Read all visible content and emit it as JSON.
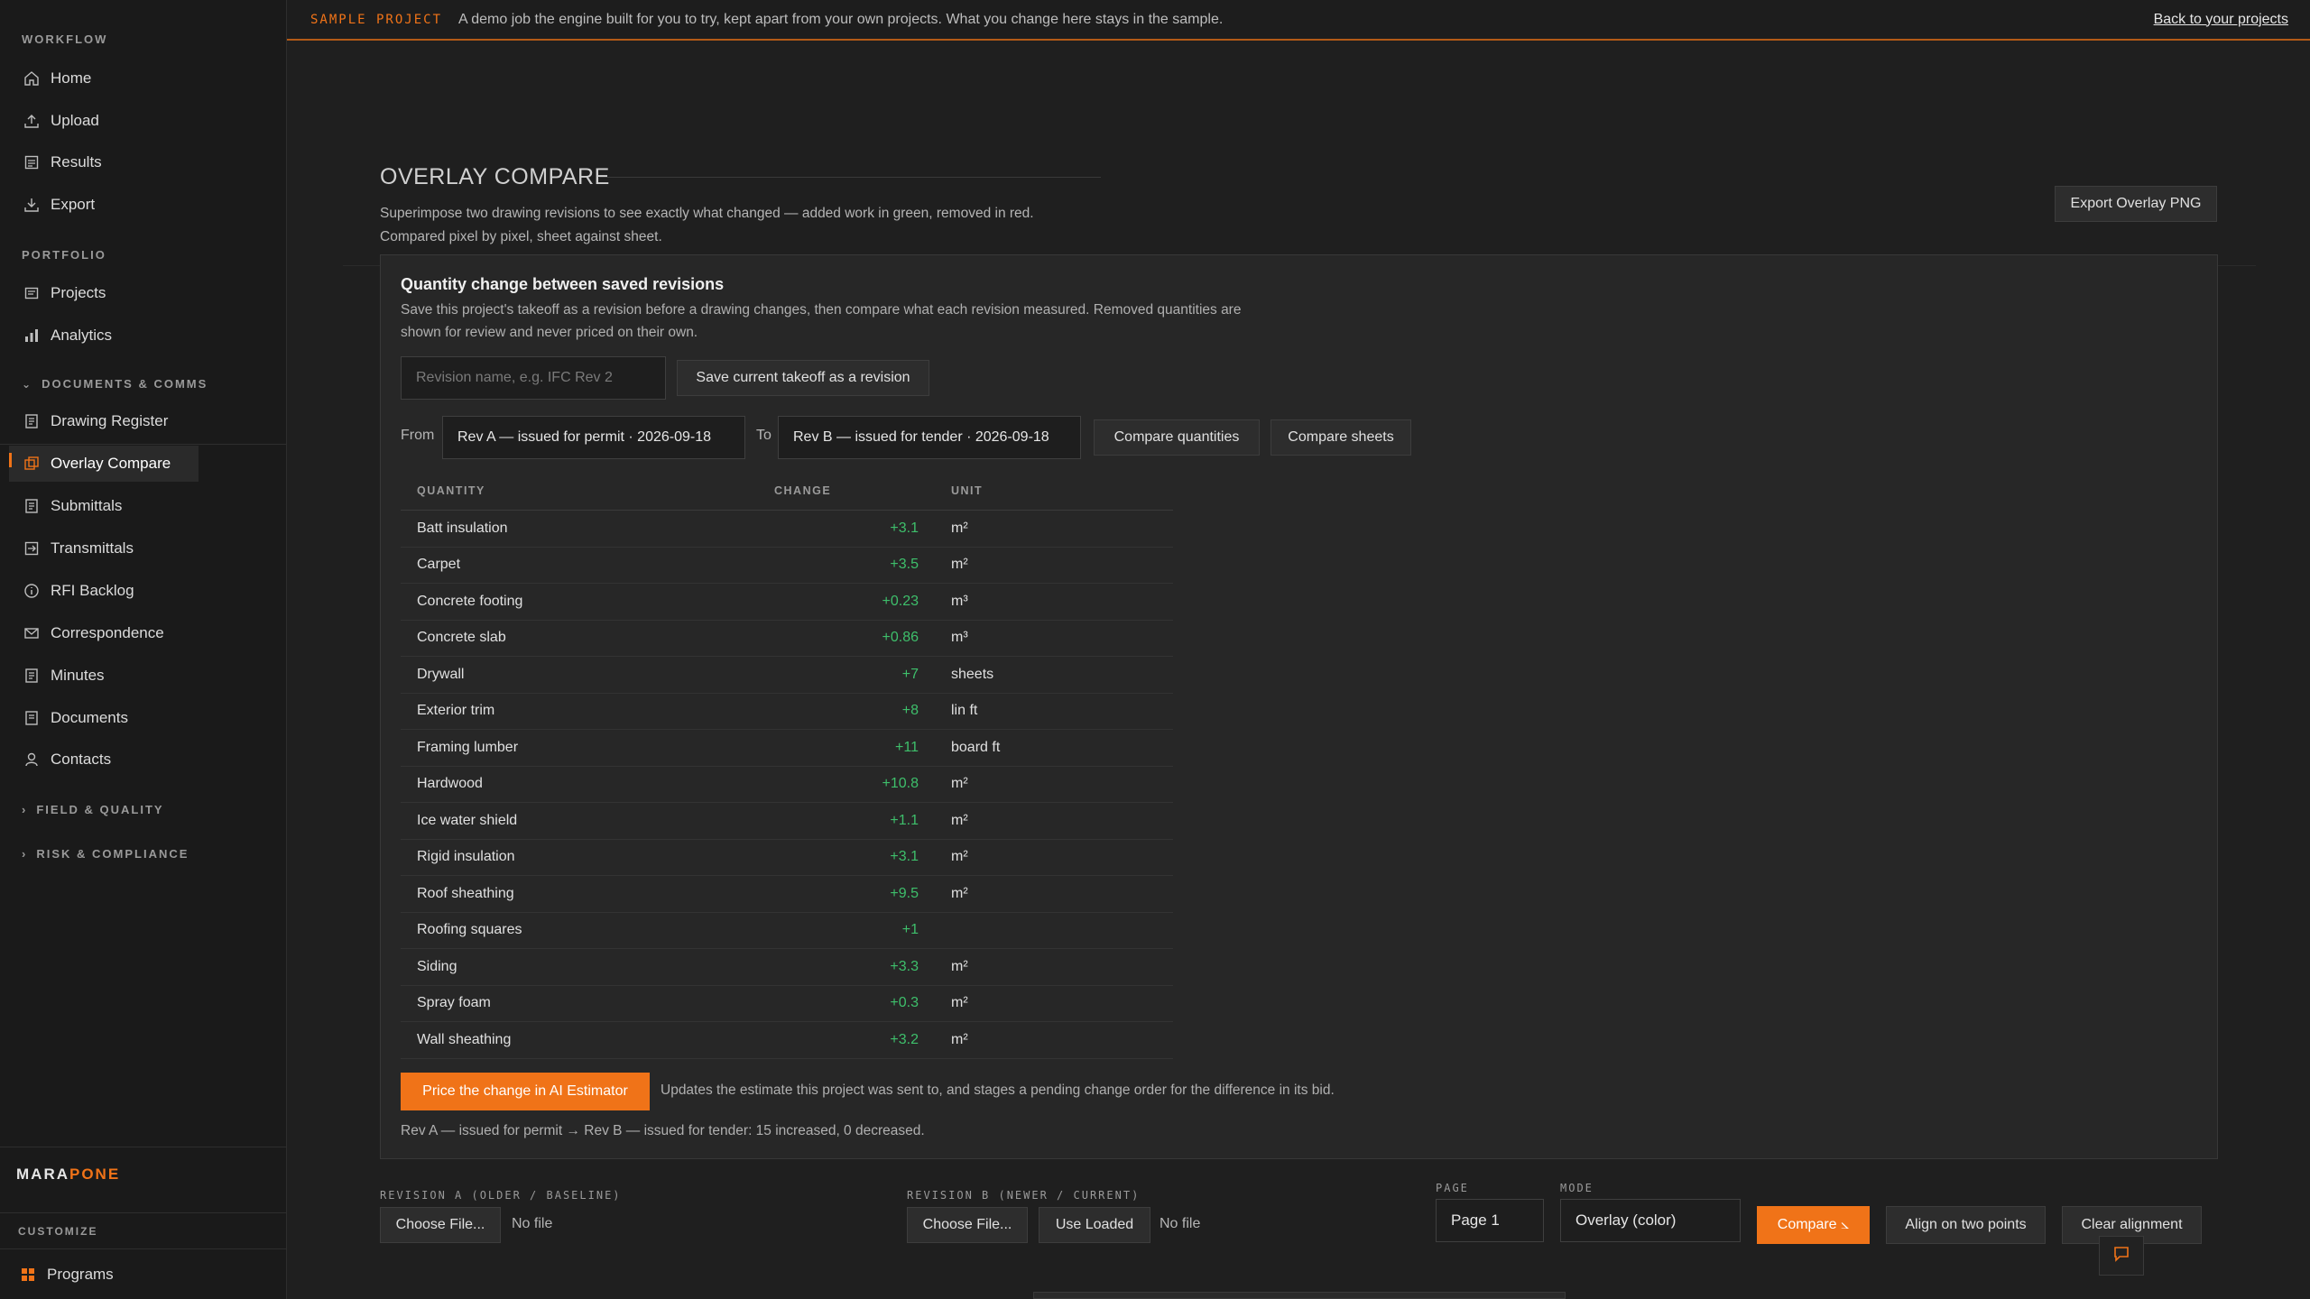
{
  "banner": {
    "tag": "SAMPLE PROJECT",
    "message": "A demo job the engine built for you to try, kept apart from your own projects. What you change here stays in the sample.",
    "back_link": "Back to your projects"
  },
  "sidebar": {
    "workflow_label": "WORKFLOW",
    "workflow": [
      {
        "label": "Home",
        "icon": "home-icon"
      },
      {
        "label": "Upload",
        "icon": "upload-icon"
      },
      {
        "label": "Results",
        "icon": "results-icon"
      },
      {
        "label": "Export",
        "icon": "download-icon"
      }
    ],
    "portfolio_label": "PORTFOLIO",
    "portfolio": [
      {
        "label": "Projects",
        "icon": "projects-icon"
      },
      {
        "label": "Analytics",
        "icon": "bar-chart-icon"
      }
    ],
    "docs_label": "DOCUMENTS & COMMS",
    "docs": [
      {
        "label": "Drawing Register",
        "icon": "document-icon"
      },
      {
        "label": "Overlay Compare",
        "icon": "overlay-icon",
        "active": true
      },
      {
        "label": "Submittals",
        "icon": "document-icon"
      },
      {
        "label": "Transmittals",
        "icon": "transmittal-icon"
      },
      {
        "label": "RFI Backlog",
        "icon": "info-icon"
      },
      {
        "label": "Correspondence",
        "icon": "mail-icon"
      },
      {
        "label": "Minutes",
        "icon": "document-icon"
      },
      {
        "label": "Documents",
        "icon": "documents-icon"
      },
      {
        "label": "Contacts",
        "icon": "user-icon"
      }
    ],
    "field_label": "FIELD & QUALITY",
    "risk_label": "RISK & COMPLIANCE",
    "brand_a": "MARA",
    "brand_b": "PONE",
    "customize_label": "CUSTOMIZE",
    "programs": "Programs"
  },
  "main": {
    "title": "OVERLAY COMPARE",
    "description_1": "Superimpose two drawing revisions to see exactly what changed — added work in green, removed in red.",
    "description_2": "Compared pixel by pixel, sheet against sheet.",
    "export_button": "Export Overlay PNG"
  },
  "panel": {
    "title": "Quantity change between saved revisions",
    "description": "Save this project's takeoff as a revision before a drawing changes, then compare what each revision measured. Removed quantities are shown for review and never priced on their own.",
    "revision_placeholder": "Revision name, e.g. IFC Rev 2",
    "save_button": "Save current takeoff as a revision",
    "from_label": "From",
    "from_value": "Rev A — issued for permit · 2026-09-18",
    "to_label": "To",
    "to_value": "Rev B — issued for tender · 2026-09-18",
    "compare_quantities": "Compare quantities",
    "compare_sheets": "Compare sheets",
    "columns": [
      "QUANTITY",
      "CHANGE",
      "UNIT"
    ],
    "rows": [
      {
        "name": "Batt insulation",
        "change": "+3.1",
        "unit": "m²"
      },
      {
        "name": "Carpet",
        "change": "+3.5",
        "unit": "m²"
      },
      {
        "name": "Concrete footing",
        "change": "+0.23",
        "unit": "m³"
      },
      {
        "name": "Concrete slab",
        "change": "+0.86",
        "unit": "m³"
      },
      {
        "name": "Drywall",
        "change": "+7",
        "unit": "sheets"
      },
      {
        "name": "Exterior trim",
        "change": "+8",
        "unit": "lin ft"
      },
      {
        "name": "Framing lumber",
        "change": "+11",
        "unit": "board ft"
      },
      {
        "name": "Hardwood",
        "change": "+10.8",
        "unit": "m²"
      },
      {
        "name": "Ice water shield",
        "change": "+1.1",
        "unit": "m²"
      },
      {
        "name": "Rigid insulation",
        "change": "+3.1",
        "unit": "m²"
      },
      {
        "name": "Roof sheathing",
        "change": "+9.5",
        "unit": "m²"
      },
      {
        "name": "Roofing squares",
        "change": "+1",
        "unit": ""
      },
      {
        "name": "Siding",
        "change": "+3.3",
        "unit": "m²"
      },
      {
        "name": "Spray foam",
        "change": "+0.3",
        "unit": "m²"
      },
      {
        "name": "Wall sheathing",
        "change": "+3.2",
        "unit": "m²"
      }
    ],
    "price_button": "Price the change in AI Estimator",
    "price_note": "Updates the estimate this project was sent to, and stages a pending change order for the difference in its bid.",
    "summary": "Rev A — issued for permit → Rev B — issued for tender: 15 increased, 0 decreased."
  },
  "controls": {
    "rev_a_label": "REVISION A (OLDER / BASELINE)",
    "rev_b_label": "REVISION B (NEWER / CURRENT)",
    "choose_file": "Choose File...",
    "no_file": "No file",
    "use_loaded": "Use Loaded",
    "page_label": "PAGE",
    "page_value": "Page 1",
    "mode_label": "MODE",
    "mode_value": "Overlay (color)",
    "compare_button": "Compare ⦣",
    "align_button": "Align on two points",
    "clear_button": "Clear alignment"
  },
  "colors": {
    "accent": "#f07318",
    "increase": "#3ebf6b",
    "background": "#1f1f1f",
    "panel": "#272727"
  }
}
